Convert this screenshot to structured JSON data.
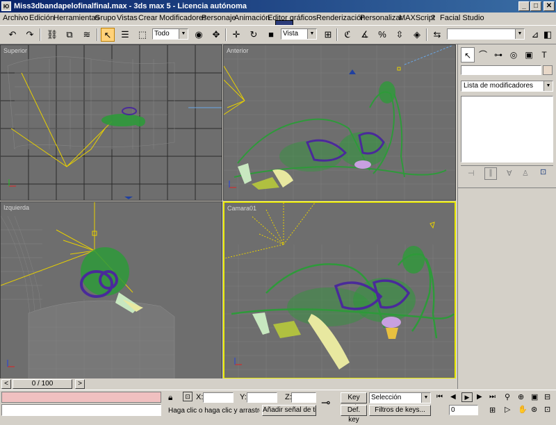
{
  "window": {
    "icon_text": "Ю",
    "title": "Miss3dbandapelofinalfinal.max - 3ds max 5 - Licencia autónoma",
    "minimize": "_",
    "maximize": "□",
    "close": "✕"
  },
  "menu": {
    "items": [
      "Archivo",
      "Edición",
      "Herramientas",
      "Grupo",
      "Vistas",
      "Crear",
      "Modificadores",
      "Personaje",
      "Animación",
      "Editor gráficos",
      "Renderización",
      "Personalizar",
      "MAXScript",
      "?",
      "Facial Studio"
    ]
  },
  "toolbar": {
    "selection_filter": "Todo",
    "reference_coord": "Vista"
  },
  "viewports": {
    "top_label": "Superior",
    "front_label": "Anterior",
    "left_label": "Izquierda",
    "camera_label": "Camara01"
  },
  "command_panel": {
    "modifier_list": "Lista de modificadores"
  },
  "time_slider": {
    "frame": "0 / 100",
    "prev": "<",
    "next": ">"
  },
  "status": {
    "x_label": "X:",
    "y_label": "Y:",
    "z_label": "Z:",
    "prompt": "Haga clic o haga clic y arrastre par",
    "add_time_tag": "Añadir señal de tiem",
    "key_auto": "Key auto",
    "selection_mode": "Selección",
    "def_key": "Def. key",
    "key_filters": "Filtros de keys...",
    "frame_value": "0"
  },
  "colors": {
    "title_start": "#0a246a",
    "title_end": "#3a6ea5",
    "viewport_bg": "#6e6e6e",
    "mesh_green": "#2e9a3a",
    "mesh_purple": "#4a2a9a",
    "light_yellow": "#e8d000",
    "active_border": "#e8e800"
  }
}
